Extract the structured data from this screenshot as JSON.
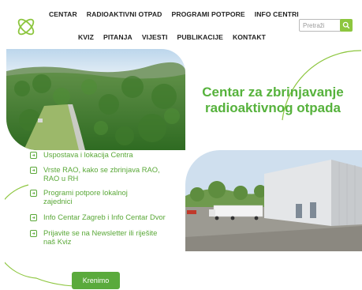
{
  "nav": {
    "row1": [
      "CENTAR",
      "RADIOAKTIVNI OTPAD",
      "PROGRAMI POTPORE",
      "INFO CENTRI"
    ],
    "row2": [
      "KVIZ",
      "PITANJA",
      "VIJESTI",
      "PUBLIKACIJE",
      "KONTAKT"
    ]
  },
  "search": {
    "placeholder": "Pretraži"
  },
  "hero": {
    "title_line1": "Centar za zbrinjavanje",
    "title_line2": "radioaktivnog otpada"
  },
  "list": [
    "Uspostava i lokacija Centra",
    "Vrste RAO, kako se zbrinjava RAO, RAO u RH",
    "Programi potpore lokalnoj zajednici",
    "Info Centar Zagreb i Info Centar Dvor",
    "Prijavite se na Newsletter ili riješite naš Kviz"
  ],
  "cta": {
    "label": "Krenimo"
  },
  "colors": {
    "accent": "#5aaa3c",
    "search_button": "#8dc63f",
    "title": "#56b23c"
  }
}
